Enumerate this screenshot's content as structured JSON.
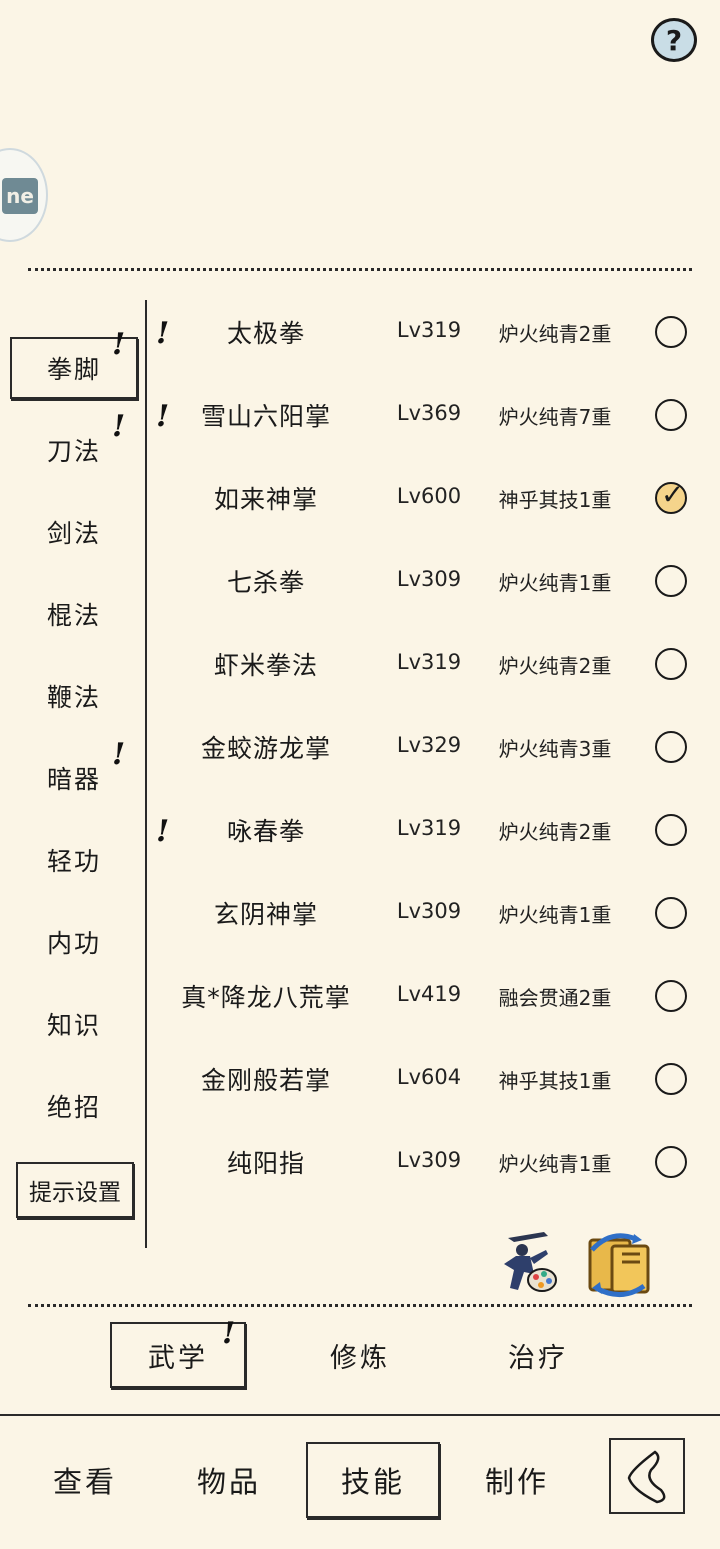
{
  "header": {
    "help_label": "?",
    "badge_text": "ne"
  },
  "categories": [
    {
      "label": "拳脚",
      "active": true,
      "alert": true
    },
    {
      "label": "刀法",
      "active": false,
      "alert": true
    },
    {
      "label": "剑法",
      "active": false,
      "alert": false
    },
    {
      "label": "棍法",
      "active": false,
      "alert": false
    },
    {
      "label": "鞭法",
      "active": false,
      "alert": false
    },
    {
      "label": "暗器",
      "active": false,
      "alert": true
    },
    {
      "label": "轻功",
      "active": false,
      "alert": false
    },
    {
      "label": "内功",
      "active": false,
      "alert": false
    },
    {
      "label": "知识",
      "active": false,
      "alert": false
    },
    {
      "label": "绝招",
      "active": false,
      "alert": false
    }
  ],
  "hint_settings_label": "提示设置",
  "alert_mark": "!",
  "skills": [
    {
      "name": "太极拳",
      "level": "Lv319",
      "rank": "炉火纯青2重",
      "selected": false,
      "alert": true
    },
    {
      "name": "雪山六阳掌",
      "level": "Lv369",
      "rank": "炉火纯青7重",
      "selected": false,
      "alert": true
    },
    {
      "name": "如来神掌",
      "level": "Lv600",
      "rank": "神乎其技1重",
      "selected": true,
      "alert": false
    },
    {
      "name": "七杀拳",
      "level": "Lv309",
      "rank": "炉火纯青1重",
      "selected": false,
      "alert": false
    },
    {
      "name": "虾米拳法",
      "level": "Lv319",
      "rank": "炉火纯青2重",
      "selected": false,
      "alert": false
    },
    {
      "name": "金蛟游龙掌",
      "level": "Lv329",
      "rank": "炉火纯青3重",
      "selected": false,
      "alert": false
    },
    {
      "name": "咏春拳",
      "level": "Lv319",
      "rank": "炉火纯青2重",
      "selected": false,
      "alert": true
    },
    {
      "name": "玄阴神掌",
      "level": "Lv309",
      "rank": "炉火纯青1重",
      "selected": false,
      "alert": false
    },
    {
      "name": "真*降龙八荒掌",
      "level": "Lv419",
      "rank": "融会贯通2重",
      "selected": false,
      "alert": false
    },
    {
      "name": "金刚般若掌",
      "level": "Lv604",
      "rank": "神乎其技1重",
      "selected": false,
      "alert": false
    },
    {
      "name": "纯阳指",
      "level": "Lv309",
      "rank": "炉火纯青1重",
      "selected": false,
      "alert": false
    }
  ],
  "tool_icons": [
    "martial-artist-palette-icon",
    "book-swap-icon"
  ],
  "tabs": [
    {
      "label": "武学",
      "active": true,
      "alert": true
    },
    {
      "label": "修炼",
      "active": false,
      "alert": false
    },
    {
      "label": "治疗",
      "active": false,
      "alert": false
    }
  ],
  "nav": [
    {
      "label": "查看",
      "active": false
    },
    {
      "label": "物品",
      "active": false
    },
    {
      "label": "技能",
      "active": true
    },
    {
      "label": "制作",
      "active": false
    }
  ],
  "colors": {
    "background": "#fbf5e6",
    "ink": "#1a1a1a",
    "checked_fill": "#f5d48b",
    "help_fill": "#c9dde6"
  }
}
